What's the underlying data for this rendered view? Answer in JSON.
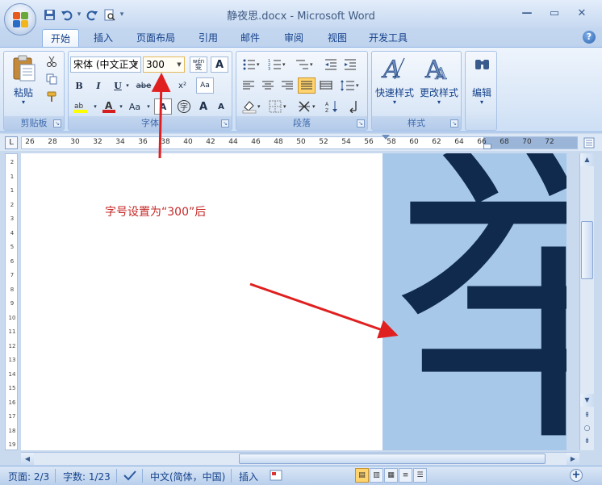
{
  "window": {
    "title": "静夜思.docx - Microsoft Word",
    "controls": [
      "—",
      "▭",
      "✕"
    ]
  },
  "tabs": [
    "开始",
    "插入",
    "页面布局",
    "引用",
    "邮件",
    "审阅",
    "视图",
    "开发工具"
  ],
  "ribbon": {
    "clipboard": {
      "paste_label": "粘贴",
      "group_label": "剪贴板"
    },
    "font": {
      "font_name": "宋体 (中文正文",
      "font_size": "300",
      "group_label": "字体",
      "wen_label": "wén\n变",
      "bold": "B",
      "italic": "I",
      "underline": "U",
      "strike": "abe",
      "sub": "x₂",
      "sup": "x²",
      "aa": "Aa",
      "a_label": "A",
      "grow": "A",
      "shrink": "A",
      "clear": "Aa"
    },
    "paragraph": {
      "group_label": "段落"
    },
    "styles": {
      "quick_styles": "快速样式",
      "change_styles": "更改样式",
      "group_label": "样式"
    },
    "editing": {
      "label": "编辑"
    }
  },
  "ruler": {
    "numbers": [
      "26",
      "28",
      "30",
      "32",
      "34",
      "36",
      "38",
      "40",
      "42",
      "44",
      "46",
      "48",
      "50",
      "52",
      "54",
      "56",
      "58",
      "60",
      "62",
      "64",
      "66",
      "68",
      "70",
      "72"
    ],
    "vnumbers": [
      "2",
      "1",
      "1",
      "2",
      "3",
      "4",
      "5",
      "6",
      "7",
      "8",
      "9",
      "10",
      "11",
      "12",
      "13",
      "14",
      "15",
      "16",
      "17",
      "18",
      "19"
    ]
  },
  "document": {
    "big_char": "举",
    "annotation": "字号设置为“300”后"
  },
  "statusbar": {
    "page": "页面: 2/3",
    "words": "字数: 1/23",
    "language": "中文(简体，中国)",
    "insert_mode": "插入"
  },
  "colors": {
    "annotation": "#c62828",
    "arrow": "#e02020",
    "char": "#0f2a4c",
    "selection": "#a8c8ea"
  }
}
